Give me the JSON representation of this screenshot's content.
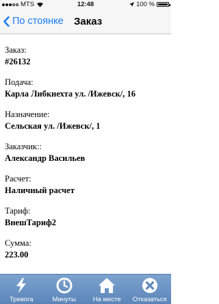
{
  "statusbar": {
    "carrier": "MTS",
    "time": "12:48",
    "battery_text": "100 %",
    "battery_level": 1.0
  },
  "navbar": {
    "back_label": "По стоянке",
    "title": "Заказ"
  },
  "order": {
    "number_label": "Заказ:",
    "number_value": "#26132",
    "pickup_label": "Подача:",
    "pickup_value": "Карла Либкнехта ул. /Ижевск/, 16",
    "destination_label": "Назначение:",
    "destination_value": "Сельская ул. /Ижевск/, 1",
    "customer_label": "Заказчик::",
    "customer_value": "Александр Васильев",
    "payment_label": "Расчет:",
    "payment_value": "Наличный расчет",
    "tariff_label": "Тариф:",
    "tariff_value": "ВнешТариф2",
    "sum_label": "Сумма:",
    "sum_value": "223.00"
  },
  "tabbar": {
    "tabs": [
      {
        "label": "Тревога",
        "icon": "lightning-icon"
      },
      {
        "label": "Минуты",
        "icon": "clock-icon"
      },
      {
        "label": "На месте",
        "icon": "home-icon"
      },
      {
        "label": "Отказаться",
        "icon": "cancel-icon"
      }
    ]
  },
  "colors": {
    "accent": "#1a7cf2",
    "tabbar_top": "#7da3cf",
    "tabbar_bottom": "#5b85b9"
  }
}
